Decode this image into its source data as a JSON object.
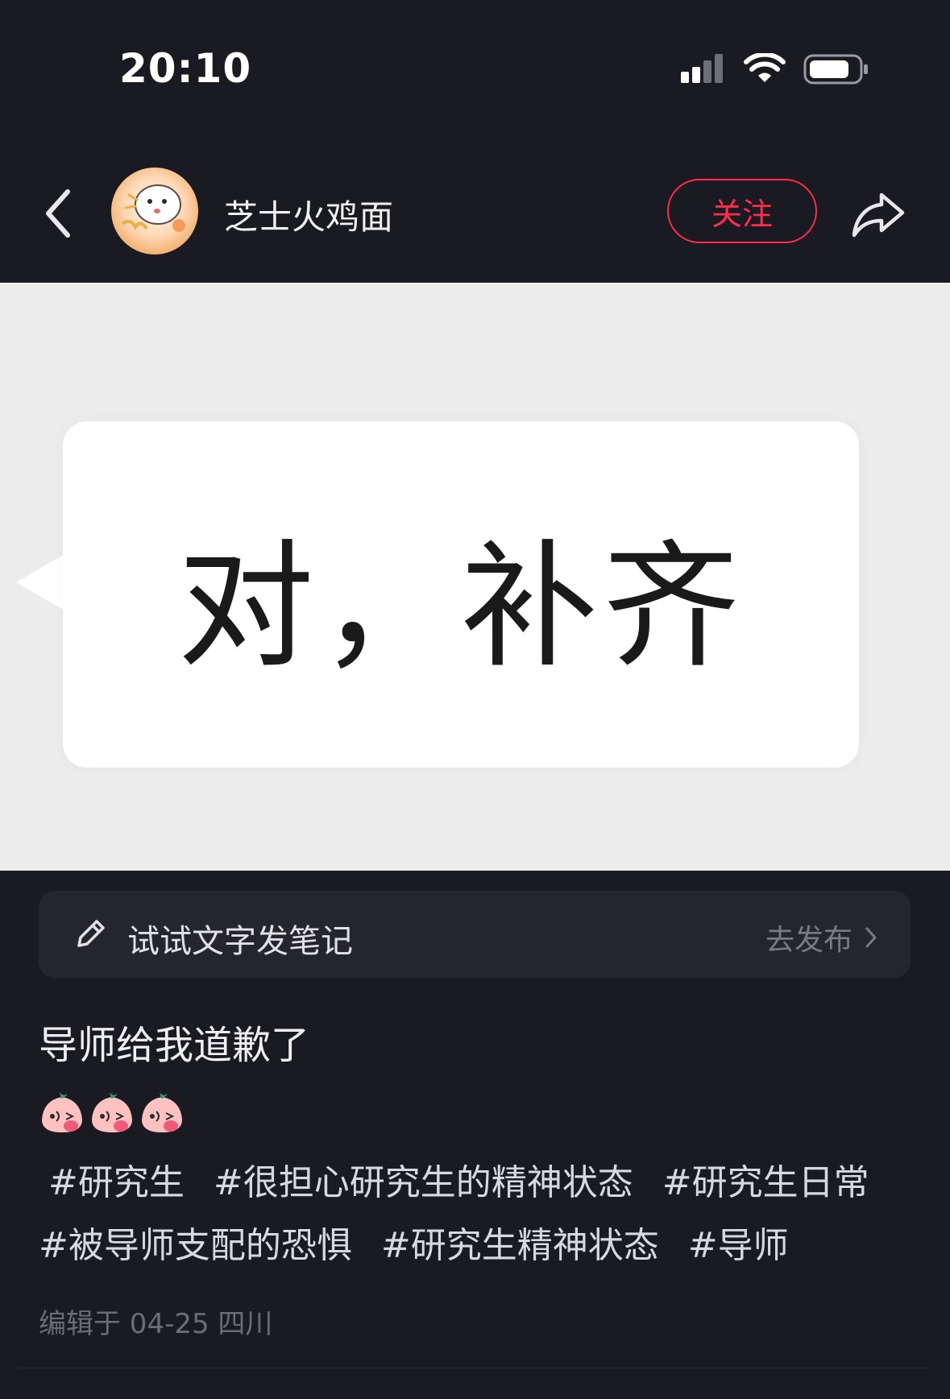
{
  "status_bar": {
    "time": "20:10"
  },
  "header": {
    "author_name": "芝士火鸡面",
    "follow_label": "关注"
  },
  "image": {
    "bubble_text": "对，补齐"
  },
  "compose": {
    "label": "试试文字发笔记",
    "action_label": "去发布"
  },
  "post": {
    "title": "导师给我道歉了",
    "emoji_count": 3,
    "tags": [
      "#研究生",
      "#很担心研究生的精神状态",
      "#研究生日常",
      "#被导师支配的恐惧",
      "#研究生精神状态",
      "#导师"
    ],
    "edit_meta": "编辑于 04-25 四川"
  },
  "colors": {
    "background": "#1a1a22",
    "accent": "#ff2d4a",
    "image_bg": "#ececec"
  }
}
